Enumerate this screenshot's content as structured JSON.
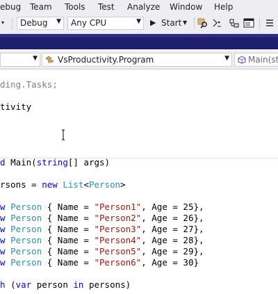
{
  "menu": {
    "items": [
      "ebug",
      "Team",
      "Tools",
      "Test",
      "Analyze",
      "Window",
      "Help"
    ]
  },
  "toolbar": {
    "config": "Debug",
    "platform": "Any CPU",
    "start_label": "Start"
  },
  "navbar": {
    "type_scope": "VsProductivity.Program",
    "member_scope": "Main(str"
  },
  "editor": {
    "lines": [
      {
        "segments": [
          {
            "t": "ding.Tasks;",
            "c": "gr"
          }
        ]
      },
      {
        "segments": [
          {
            "t": "tivity",
            "c": "pl"
          }
        ]
      },
      {
        "segments": [
          {
            "t": "d ",
            "c": "kw"
          },
          {
            "t": "Main(",
            "c": "pl"
          },
          {
            "t": "string",
            "c": "kw"
          },
          {
            "t": "[] args)",
            "c": "pl"
          }
        ]
      },
      {
        "segments": [
          {
            "t": "rsons = ",
            "c": "pl"
          },
          {
            "t": "new ",
            "c": "kw"
          },
          {
            "t": "List",
            "c": "ty"
          },
          {
            "t": "<",
            "c": "pl"
          },
          {
            "t": "Person",
            "c": "ty"
          },
          {
            "t": ">",
            "c": "pl"
          }
        ]
      },
      {
        "segments": [
          {
            "t": "w ",
            "c": "kw"
          },
          {
            "t": "Person",
            "c": "ty"
          },
          {
            "t": " { Name = ",
            "c": "pl"
          },
          {
            "t": "\"Person1\"",
            "c": "st"
          },
          {
            "t": ", Age = 25},",
            "c": "pl"
          }
        ]
      },
      {
        "segments": [
          {
            "t": "w ",
            "c": "kw"
          },
          {
            "t": "Person",
            "c": "ty"
          },
          {
            "t": " { Name = ",
            "c": "pl"
          },
          {
            "t": "\"Person2\"",
            "c": "st"
          },
          {
            "t": ", Age = 26},",
            "c": "pl"
          }
        ]
      },
      {
        "segments": [
          {
            "t": "w ",
            "c": "kw"
          },
          {
            "t": "Person",
            "c": "ty"
          },
          {
            "t": " { Name = ",
            "c": "pl"
          },
          {
            "t": "\"Person3\"",
            "c": "st"
          },
          {
            "t": ", Age = 27},",
            "c": "pl"
          }
        ]
      },
      {
        "segments": [
          {
            "t": "w ",
            "c": "kw"
          },
          {
            "t": "Person",
            "c": "ty"
          },
          {
            "t": " { Name = ",
            "c": "pl"
          },
          {
            "t": "\"Person4\"",
            "c": "st"
          },
          {
            "t": ", Age = 28},",
            "c": "pl"
          }
        ]
      },
      {
        "segments": [
          {
            "t": "w ",
            "c": "kw"
          },
          {
            "t": "Person",
            "c": "ty"
          },
          {
            "t": " { Name = ",
            "c": "pl"
          },
          {
            "t": "\"Person5\"",
            "c": "st"
          },
          {
            "t": ", Age = 29},",
            "c": "pl"
          }
        ]
      },
      {
        "segments": [
          {
            "t": "w ",
            "c": "kw"
          },
          {
            "t": "Person",
            "c": "ty"
          },
          {
            "t": " { Name = ",
            "c": "pl"
          },
          {
            "t": "\"Person6\"",
            "c": "st"
          },
          {
            "t": ", Age = 30}",
            "c": "pl"
          }
        ]
      },
      {
        "segments": [
          {
            "t": "h ",
            "c": "kw"
          },
          {
            "t": "(",
            "c": "pl"
          },
          {
            "t": "var ",
            "c": "kw"
          },
          {
            "t": "person ",
            "c": "pl"
          },
          {
            "t": "in ",
            "c": "kw"
          },
          {
            "t": "persons)",
            "c": "pl"
          }
        ]
      }
    ]
  },
  "colors": {
    "keyword": "#0000ff",
    "type": "#2b91af",
    "string": "#a31515",
    "comment_gray": "#808080",
    "chrome": "#eeeef2",
    "title_strip": "#1e1e6e"
  },
  "icons": [
    "find-in-files-icon",
    "step-over-icon",
    "toolbox-icon",
    "properties-icon",
    "class-icon",
    "method-icon",
    "play-icon"
  ]
}
